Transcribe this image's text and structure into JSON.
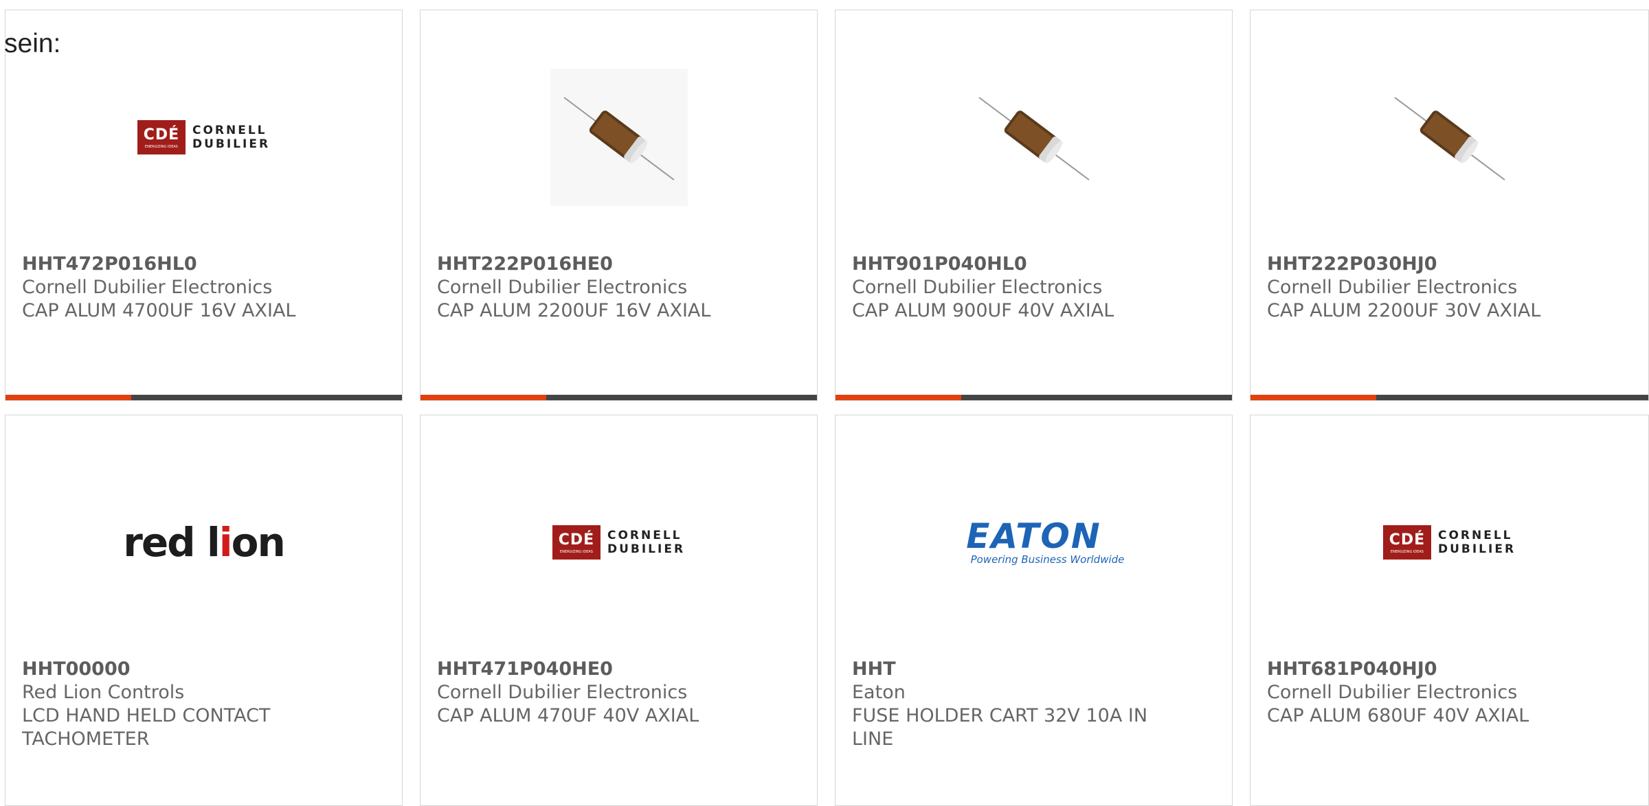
{
  "intro": {
    "text": "sein:"
  },
  "colors": {
    "accent": "#e0410f",
    "bar": "#444444",
    "border": "#d6d6d6"
  },
  "products": [
    {
      "part": "HHT472P016HL0",
      "maker": "Cornell Dubilier Electronics",
      "desc": [
        "CAP ALUM 4700UF 16V AXIAL"
      ],
      "image": "cornell-dubilier-logo",
      "logo_text": [
        "CDÉ",
        "ENERGIZING IDEAS",
        "CORNELL",
        "DUBILIER"
      ]
    },
    {
      "part": "HHT222P016HE0",
      "maker": "Cornell Dubilier Electronics",
      "desc": [
        "CAP ALUM 2200UF 16V AXIAL"
      ],
      "image": "axial-capacitor-photo"
    },
    {
      "part": "HHT901P040HL0",
      "maker": "Cornell Dubilier Electronics",
      "desc": [
        "CAP ALUM 900UF 40V AXIAL"
      ],
      "image": "axial-capacitor-photo"
    },
    {
      "part": "HHT222P030HJ0",
      "maker": "Cornell Dubilier Electronics",
      "desc": [
        "CAP ALUM 2200UF 30V AXIAL"
      ],
      "image": "axial-capacitor-photo"
    },
    {
      "part": "HHT00000",
      "maker": "Red Lion Controls",
      "desc": [
        "LCD HAND HELD CONTACT",
        "TACHOMETER"
      ],
      "image": "red-lion-logo",
      "logo_text": [
        "red l",
        "i",
        "on"
      ]
    },
    {
      "part": "HHT471P040HE0",
      "maker": "Cornell Dubilier Electronics",
      "desc": [
        "CAP ALUM 470UF 40V AXIAL"
      ],
      "image": "cornell-dubilier-logo",
      "logo_text": [
        "CDÉ",
        "ENERGIZING IDEAS",
        "CORNELL",
        "DUBILIER"
      ]
    },
    {
      "part": "HHT",
      "maker": "Eaton",
      "desc": [
        "FUSE HOLDER CART 32V 10A IN",
        "LINE"
      ],
      "image": "eaton-logo",
      "logo_text": [
        "EATON",
        "Powering Business Worldwide"
      ]
    },
    {
      "part": "HHT681P040HJ0",
      "maker": "Cornell Dubilier Electronics",
      "desc": [
        "CAP ALUM 680UF 40V AXIAL"
      ],
      "image": "cornell-dubilier-logo",
      "logo_text": [
        "CDÉ",
        "ENERGIZING IDEAS",
        "CORNELL",
        "DUBILIER"
      ]
    }
  ]
}
